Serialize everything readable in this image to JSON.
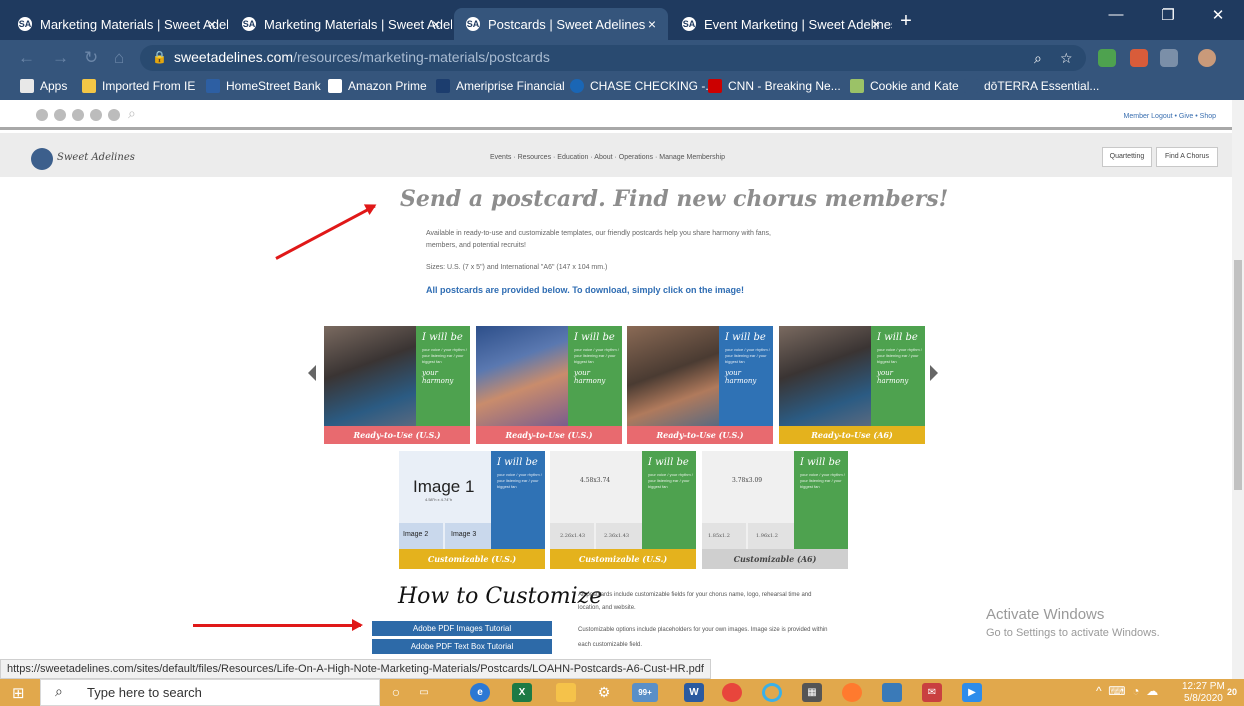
{
  "browser": {
    "tabs": [
      {
        "title": "Marketing Materials | Sweet Adel",
        "active": false
      },
      {
        "title": "Marketing Materials | Sweet Adel",
        "active": false
      },
      {
        "title": "Postcards | Sweet Adelines",
        "active": true
      },
      {
        "title": "Event Marketing | Sweet Adelines",
        "active": false
      }
    ],
    "close_glyph": "×",
    "new_tab_glyph": "+",
    "url_domain": "sweetadelines.com",
    "url_path": "/resources/marketing-materials/postcards",
    "bookmarks": [
      {
        "label": "Apps",
        "icon": "apps-grid-icon",
        "color": "#e8e8e8"
      },
      {
        "label": "Imported From IE",
        "icon": "folder-icon",
        "color": "#f3c646"
      },
      {
        "label": "HomeStreet Bank",
        "icon": "homestreet-icon",
        "color": "#2d5fa3"
      },
      {
        "label": "Amazon Prime",
        "icon": "amazon-icon",
        "color": "#ffffff"
      },
      {
        "label": "Ameriprise Financial",
        "icon": "ameriprise-icon",
        "color": "#1c3d6e"
      },
      {
        "label": "CHASE CHECKING -...",
        "icon": "chase-icon",
        "color": "#1a66b5"
      },
      {
        "label": "CNN - Breaking Ne...",
        "icon": "cnn-icon",
        "color": "#cc0000"
      },
      {
        "label": "Cookie and Kate",
        "icon": "cookie-icon",
        "color": "#9bc267"
      },
      {
        "label": "dōTERRA Essential...",
        "icon": "doterra-icon",
        "color": "#35557c"
      }
    ]
  },
  "site": {
    "top_links": "Member Logout  •  Give  •  Shop",
    "logo_text": "Sweet Adelines",
    "menu": "Events  ·  Resources  ·  Education  ·  About  ·  Operations  ·  Manage Membership",
    "nav_buttons": [
      "Quartetting",
      "Find A Chorus"
    ],
    "headline": "Send a postcard. Find new chorus members!",
    "intro_1": "Available in ready-to-use and customizable templates, our friendly postcards help you share harmony with fans,",
    "intro_2": "members, and potential recruits!",
    "sizes": "Sizes: U.S. (7 x 5\") and International \"A6\" (147 x 104 mm.)",
    "download_note": "All postcards are provided below. To download, simply click on the image!",
    "ready_cards": [
      {
        "caption": "Ready-to-Use (U.S.)",
        "cap_color": "#e86a6f",
        "panel_color": "#4ea24f"
      },
      {
        "caption": "Ready-to-Use (U.S.)",
        "cap_color": "#e86a6f",
        "panel_color": "#4ea24f"
      },
      {
        "caption": "Ready-to-Use (U.S.)",
        "cap_color": "#e86a6f",
        "panel_color": "#2f72b5"
      },
      {
        "caption": "Ready-to-Use (A6)",
        "cap_color": "#e4b21d",
        "panel_color": "#4ea24f"
      }
    ],
    "panel_script": "I will be",
    "panel_small": "your voice / your rhythm / your listening ear / your biggest fan",
    "panel_harmony": "your harmony",
    "custom_cards": [
      {
        "caption": "Customizable (U.S.)",
        "cap_color": "#e4b21d",
        "panel_color": "#2f72b5",
        "main": "Image 1",
        "main_sub": "4.58\"h x 4.74\"h",
        "smalls": [
          "Image 2",
          "Image 3"
        ]
      },
      {
        "caption": "Customizable (U.S.)",
        "cap_color": "#e4b21d",
        "panel_color": "#4ea24f",
        "main": "4.58x3.74",
        "main_sub": "",
        "smalls": [
          "2.26x1.43",
          "2.36x1.43"
        ]
      },
      {
        "caption": "Customizable (A6)",
        "cap_color": "#cfcfcf",
        "panel_color": "#4ea24f",
        "main": "3.78x3.09",
        "main_sub": "",
        "smalls": [
          "1.85x1.2",
          "1.96x1.2"
        ]
      }
    ],
    "how_to": "How to Customize",
    "tutorial_buttons": [
      "Adobe PDF Images Tutorial",
      "Adobe PDF Text Box Tutorial"
    ],
    "right_text_1": "All postcards include customizable fields for your chorus name, logo, rehearsal time and",
    "right_text_2": "location, and website.",
    "right_text_3": "Customizable options include placeholders for your own images. Image size is provided within",
    "right_text_4": "each customizable field."
  },
  "windows_watermark": {
    "title": "Activate Windows",
    "subtitle": "Go to Settings to activate Windows."
  },
  "status_url": "https://sweetadelines.com/sites/default/files/Resources/Life-On-A-High-Note-Marketing-Materials/Postcards/LOAHN-Postcards-A6-Cust-HR.pdf",
  "taskbar": {
    "search_placeholder": "Type here to search",
    "badge": "99+",
    "time": "12:27 PM",
    "date": "5/8/2020",
    "notifications": "20"
  },
  "colors": {
    "tab_bar": "#1f3a5f",
    "toolbar": "#35557c",
    "taskbar": "#e1a84c",
    "link_blue": "#2f6db3",
    "annotation_arrow": "#e01818"
  }
}
